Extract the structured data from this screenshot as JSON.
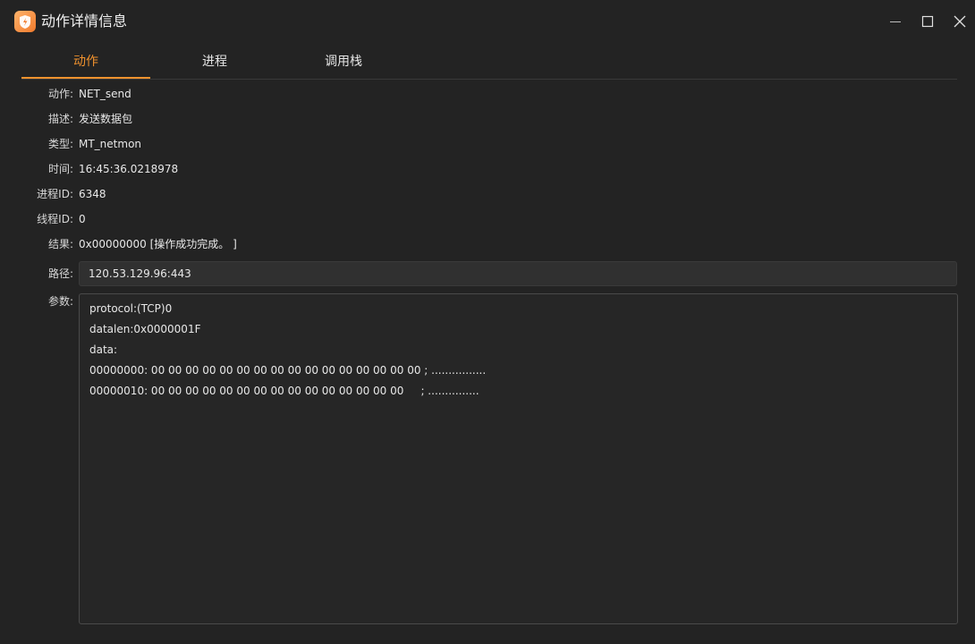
{
  "window": {
    "title": "动作详情信息",
    "accent": "#f0922e"
  },
  "tabs": [
    {
      "label": "动作",
      "active": true
    },
    {
      "label": "进程",
      "active": false
    },
    {
      "label": "调用栈",
      "active": false
    }
  ],
  "fields": {
    "action": {
      "label": "动作:",
      "value": "NET_send"
    },
    "description": {
      "label": "描述:",
      "value": "发送数据包"
    },
    "type": {
      "label": "类型:",
      "value": "MT_netmon"
    },
    "time": {
      "label": "时间:",
      "value": "16:45:36.0218978"
    },
    "pid": {
      "label": "进程ID:",
      "value": "6348"
    },
    "tid": {
      "label": "线程ID:",
      "value": "0"
    },
    "result": {
      "label": "结果:",
      "value": "0x00000000 [操作成功完成。 ]"
    },
    "path": {
      "label": "路径:",
      "value": "120.53.129.96:443"
    },
    "params": {
      "label": "参数:",
      "lines": [
        "protocol:(TCP)0",
        "datalen:0x0000001F",
        "data:",
        "00000000: 00 00 00 00 00 00 00 00 00 00 00 00 00 00 00 00 ; ................",
        "00000010: 00 00 00 00 00 00 00 00 00 00 00 00 00 00 00     ; ..............."
      ]
    }
  },
  "icons": {
    "app": "app-logo-icon",
    "minimize": "minimize-icon",
    "maximize": "maximize-icon",
    "close": "close-icon"
  }
}
